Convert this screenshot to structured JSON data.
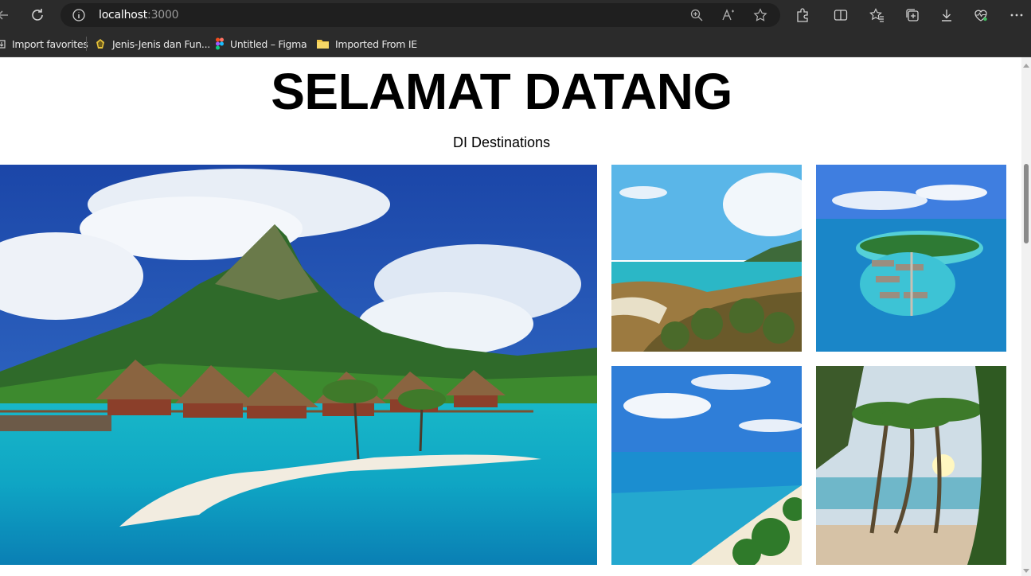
{
  "browser": {
    "url_host": "localhost",
    "url_port": ":3000",
    "bookmarks": [
      {
        "label": "Import favorites",
        "icon": "import-icon"
      },
      {
        "label": "Jenis-Jenis dan Fun...",
        "icon": "site-favicon"
      },
      {
        "label": "Untitled – Figma",
        "icon": "figma-icon"
      },
      {
        "label": "Imported From IE",
        "icon": "folder-icon"
      }
    ]
  },
  "page": {
    "title": "SELAMAT DATANG",
    "subtitle": "DI Destinations"
  },
  "gallery": {
    "images": [
      {
        "subject": "overwater bungalows beneath a mountain"
      },
      {
        "subject": "tropical coastline with palms"
      },
      {
        "subject": "aerial view of resort island"
      },
      {
        "subject": "beach with palm trees from above"
      },
      {
        "subject": "palm trees at sunset"
      }
    ]
  },
  "colors": {
    "chrome": "#2b2b2b",
    "omnibox": "#1f1f1f",
    "page_background": "#ffffff"
  }
}
